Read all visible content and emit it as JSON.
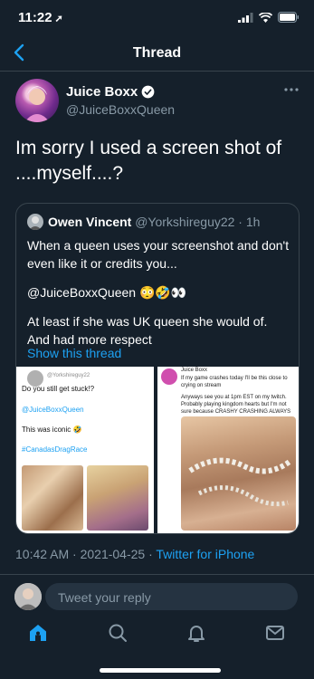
{
  "status": {
    "time": "11:22"
  },
  "nav": {
    "title": "Thread"
  },
  "tweet": {
    "author": "Juice Boxx",
    "handle": "@JuiceBoxxQueen",
    "text": "Im sorry I used a screen shot of ....myself....?",
    "timestamp": "10:42 AM · 2021-04-25 · ",
    "source": "Twitter for iPhone"
  },
  "quote": {
    "author": "Owen Vincent",
    "handle": "@Yorkshireguy22 · 1h",
    "p1": "When a queen uses your screenshot and don't even like it or credits you...",
    "p2": "@JuiceBoxxQueen 😳🤣👀",
    "p3": "At least if she was UK queen she would of. And had more respect",
    "show_thread": "Show this thread"
  },
  "media_left": {
    "handle": "@Yorkshireguy22",
    "line1": "Do you still get stuck!?",
    "mention": "@JuiceBoxxQueen",
    "line2": "This was iconic 🤣",
    "hashtag": "#CanadasDragRace"
  },
  "media_right": {
    "handle": "Juice Boxx",
    "line1": "If my game crashes today I'll be this close to crying on stream",
    "line2": "Anyways see you at 1pm EST on my twitch. Probably playing kingdom hearts but I'm not sure because CRASHY CRASHING ALWAYS"
  },
  "reply": {
    "placeholder": "Tweet your reply"
  },
  "icons": {
    "back": "chevron-left-icon",
    "verified": "verified-badge-icon",
    "more": "more-dots-icon",
    "home": "home-icon",
    "search": "search-icon",
    "notifications": "bell-icon",
    "messages": "mail-icon"
  },
  "colors": {
    "background": "#15202b",
    "accent": "#1da1f2",
    "secondary_text": "#8899a6",
    "border": "#38444d"
  }
}
